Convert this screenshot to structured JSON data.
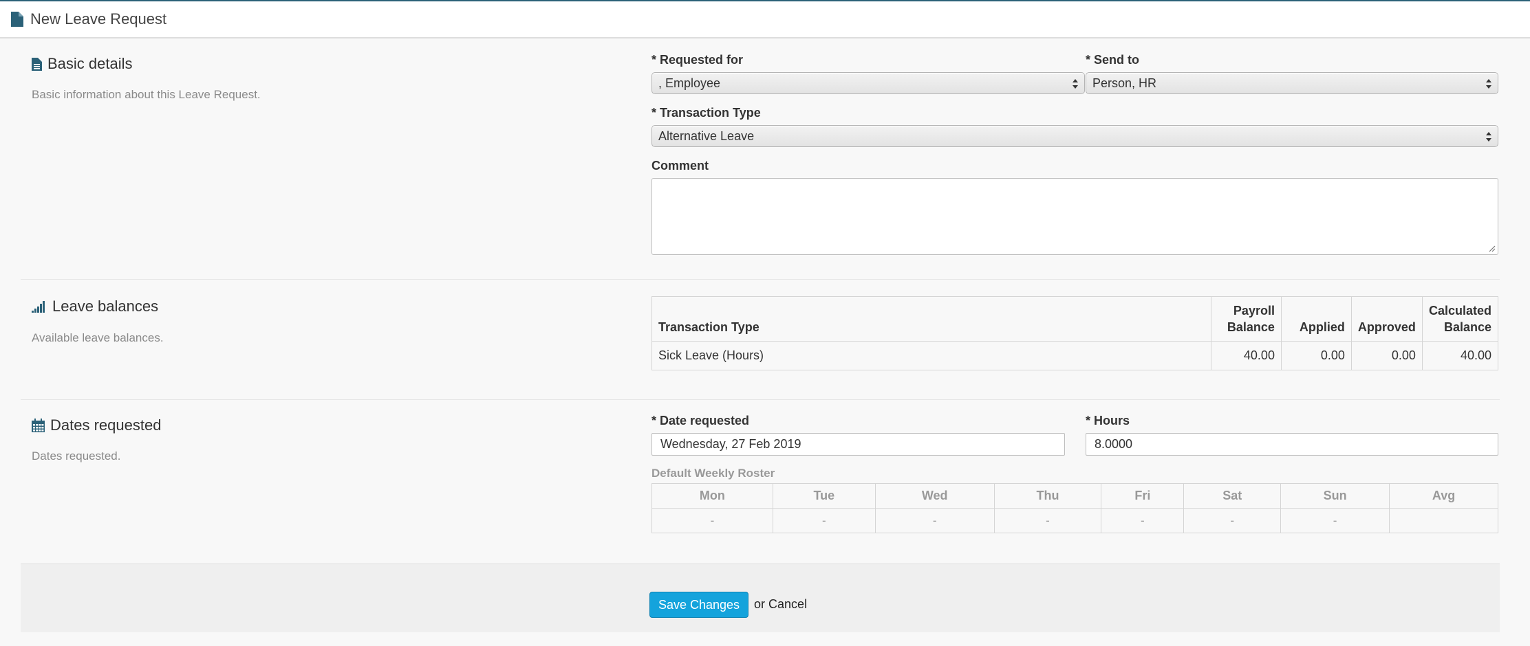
{
  "header": {
    "title": "New Leave Request"
  },
  "basic": {
    "title": "Basic details",
    "description": "Basic information about this Leave Request.",
    "requested_for": {
      "label": "* Requested for",
      "value": ", Employee"
    },
    "send_to": {
      "label": "* Send to",
      "value": "Person, HR"
    },
    "transaction_type": {
      "label": "* Transaction Type",
      "value": "Alternative Leave"
    },
    "comment": {
      "label": "Comment",
      "value": ""
    }
  },
  "balances": {
    "title": "Leave balances",
    "description": "Available leave balances.",
    "columns": [
      "Transaction Type",
      "Payroll Balance",
      "Applied",
      "Approved",
      "Calculated Balance"
    ],
    "column_lines": [
      [
        "Transaction Type"
      ],
      [
        "Payroll",
        "Balance"
      ],
      [
        "Applied"
      ],
      [
        "Approved"
      ],
      [
        "Calculated",
        "Balance"
      ]
    ],
    "rows": [
      {
        "type": "Sick Leave (Hours)",
        "payroll_balance": "40.00",
        "applied": "0.00",
        "approved": "0.00",
        "calculated_balance": "40.00"
      }
    ]
  },
  "dates": {
    "title": "Dates requested",
    "description": "Dates requested.",
    "date_requested": {
      "label": "* Date requested",
      "value": "Wednesday, 27 Feb 2019"
    },
    "hours": {
      "label": "* Hours",
      "value": "8.0000"
    },
    "roster": {
      "label": "Default Weekly Roster",
      "days": [
        "Mon",
        "Tue",
        "Wed",
        "Thu",
        "Fri",
        "Sat",
        "Sun",
        "Avg"
      ],
      "values": [
        "-",
        "-",
        "-",
        "-",
        "-",
        "-",
        "-",
        ""
      ]
    }
  },
  "footer": {
    "save_label": "Save Changes",
    "or_text": "or",
    "cancel_label": "Cancel"
  },
  "colors": {
    "accent": "#14a3dc",
    "topline": "#2b6178",
    "icon": "#2b6178"
  }
}
